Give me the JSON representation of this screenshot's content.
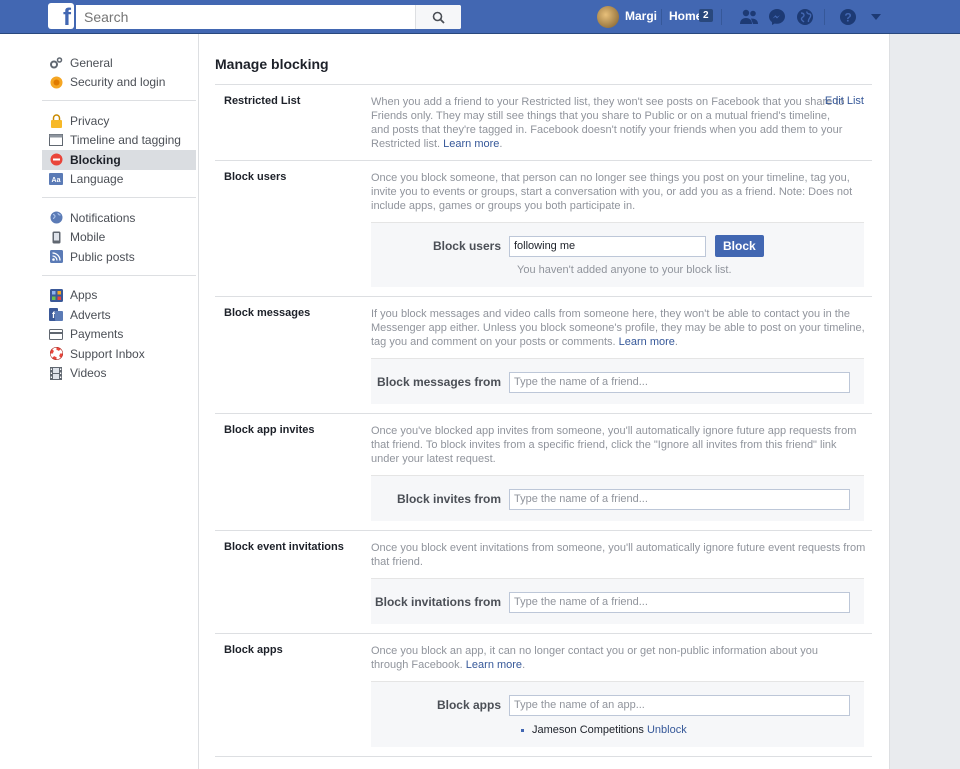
{
  "topbar": {
    "search_placeholder": "Search",
    "user_name": "Margi",
    "home_label": "Home",
    "home_count": "2"
  },
  "sidebar": {
    "groups": [
      [
        {
          "label": "General",
          "icon": "gear-icon"
        },
        {
          "label": "Security and login",
          "icon": "badge-icon"
        }
      ],
      [
        {
          "label": "Privacy",
          "icon": "lock-icon"
        },
        {
          "label": "Timeline and tagging",
          "icon": "timeline-icon"
        },
        {
          "label": "Blocking",
          "icon": "block-icon",
          "active": true
        },
        {
          "label": "Language",
          "icon": "language-icon"
        }
      ],
      [
        {
          "label": "Notifications",
          "icon": "globe-icon"
        },
        {
          "label": "Mobile",
          "icon": "mobile-icon"
        },
        {
          "label": "Public posts",
          "icon": "rss-icon"
        }
      ],
      [
        {
          "label": "Apps",
          "icon": "apps-icon"
        },
        {
          "label": "Adverts",
          "icon": "adverts-icon"
        },
        {
          "label": "Payments",
          "icon": "card-icon"
        },
        {
          "label": "Support Inbox",
          "icon": "lifebuoy-icon"
        },
        {
          "label": "Videos",
          "icon": "film-icon"
        }
      ]
    ]
  },
  "main": {
    "title": "Manage blocking",
    "restricted": {
      "label": "Restricted List",
      "desc": "When you add a friend to your Restricted list, they won't see posts on Facebook that you share to Friends only. They may still see things that you share to Public or on a mutual friend's timeline, and posts that they're tagged in. Facebook doesn't notify your friends when you add them to your Restricted list.",
      "learn_more": "Learn more",
      "edit_list": "Edit List"
    },
    "block_users": {
      "label": "Block users",
      "desc": "Once you block someone, that person can no longer see things you post on your timeline, tag you, invite you to events or groups, start a conversation with you, or add you as a friend. Note: Does not include apps, games or groups you both participate in.",
      "form_label": "Block users",
      "input_value": "following me",
      "button": "Block",
      "note": "You haven't added anyone to your block list."
    },
    "block_messages": {
      "label": "Block messages",
      "desc": "If you block messages and video calls from someone here, they won't be able to contact you in the Messenger app either. Unless you block someone's profile, they may be able to post on your timeline, tag you and comment on your posts or comments.",
      "learn_more": "Learn more",
      "form_label": "Block messages from",
      "placeholder": "Type the name of a friend..."
    },
    "block_app_invites": {
      "label": "Block app invites",
      "desc": "Once you've blocked app invites from someone, you'll automatically ignore future app requests from that friend. To block invites from a specific friend, click the \"Ignore all invites from this friend\" link under your latest request.",
      "form_label": "Block invites from",
      "placeholder": "Type the name of a friend..."
    },
    "block_event_invitations": {
      "label": "Block event invitations",
      "desc": "Once you block event invitations from someone, you'll automatically ignore future event requests from that friend.",
      "form_label": "Block invitations from",
      "placeholder": "Type the name of a friend..."
    },
    "block_apps": {
      "label": "Block apps",
      "desc": "Once you block an app, it can no longer contact you or get non-public information about you through Facebook.",
      "learn_more": "Learn more",
      "form_label": "Block apps",
      "placeholder": "Type the name of an app...",
      "blocked_name": "Jameson Competitions",
      "unblock": "Unblock"
    }
  }
}
